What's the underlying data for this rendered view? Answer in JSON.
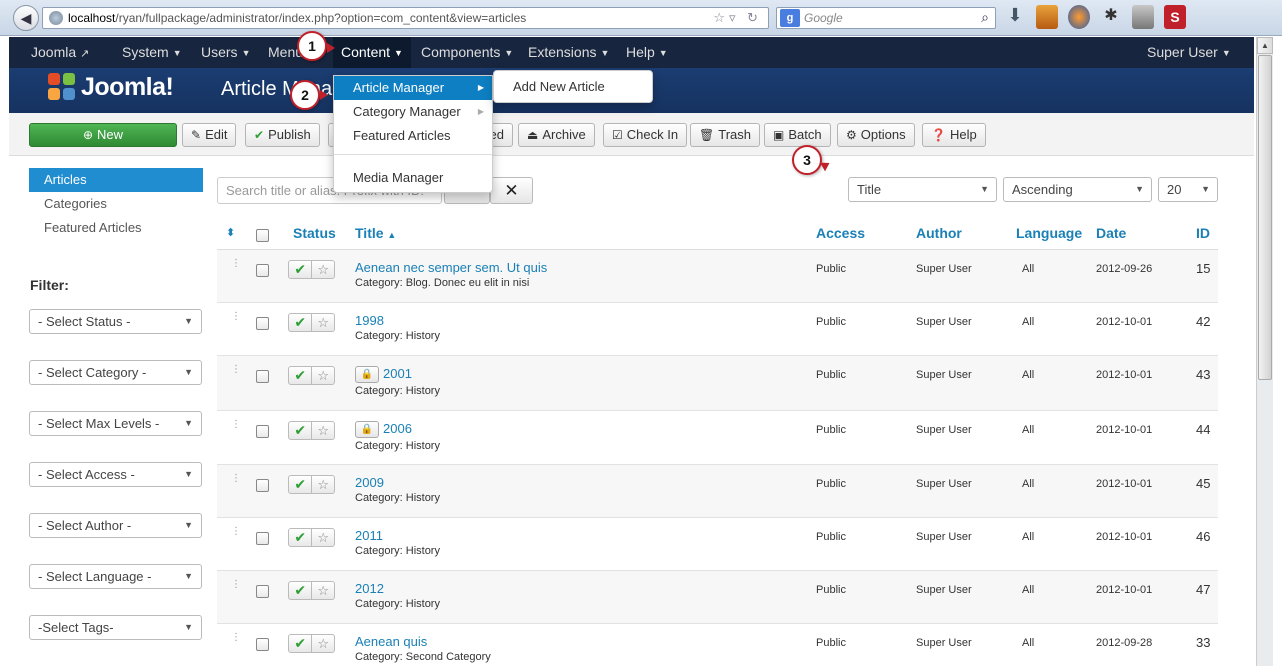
{
  "browser": {
    "url_host": "localhost",
    "url_path": "/ryan/fullpackage/administrator/index.php?option=com_content&view=articles",
    "search_placeholder": "Google",
    "search_engine_letter": "g"
  },
  "navbar": {
    "brand": "Joomla",
    "items": [
      "System",
      "Users",
      "Menus",
      "Content",
      "Components",
      "Extensions",
      "Help"
    ],
    "user": "Super User"
  },
  "header": {
    "logo_text": "Joomla!",
    "title": "Article Manager: Articles"
  },
  "toolbar": {
    "new": "New",
    "edit": "Edit",
    "publish": "Publish",
    "unpublish_fragment": "ed",
    "archive": "Archive",
    "checkin": "Check In",
    "trash": "Trash",
    "batch": "Batch",
    "options": "Options",
    "help": "Help"
  },
  "content_menu": {
    "items": [
      "Article Manager",
      "Category Manager",
      "Featured Articles",
      "Media Manager"
    ],
    "submenu_item": "Add New Article"
  },
  "sidebar": {
    "items": [
      "Articles",
      "Categories",
      "Featured Articles"
    ],
    "filter_title": "Filter:",
    "filters": [
      "- Select Status -",
      "- Select Category -",
      "- Select Max Levels -",
      "- Select Access -",
      "- Select Author -",
      "- Select Language -",
      "-Select Tags-"
    ]
  },
  "list_controls": {
    "search_placeholder": "Search title or alias. Prefix with ID:",
    "sort_field": "Title",
    "sort_direction": "Ascending",
    "limit": "20"
  },
  "table": {
    "columns": [
      "Status",
      "Title",
      "Access",
      "Author",
      "Language",
      "Date",
      "ID"
    ],
    "rows": [
      {
        "title": "Aenean nec semper sem. Ut quis",
        "category": "Category: Blog. Donec eu elit in nisi",
        "access": "Public",
        "author": "Super User",
        "language": "All",
        "date": "2012-09-26",
        "id": "15",
        "locked": false
      },
      {
        "title": "1998",
        "category": "Category: History",
        "access": "Public",
        "author": "Super User",
        "language": "All",
        "date": "2012-10-01",
        "id": "42",
        "locked": false
      },
      {
        "title": "2001",
        "category": "Category: History",
        "access": "Public",
        "author": "Super User",
        "language": "All",
        "date": "2012-10-01",
        "id": "43",
        "locked": true
      },
      {
        "title": "2006",
        "category": "Category: History",
        "access": "Public",
        "author": "Super User",
        "language": "All",
        "date": "2012-10-01",
        "id": "44",
        "locked": true
      },
      {
        "title": "2009",
        "category": "Category: History",
        "access": "Public",
        "author": "Super User",
        "language": "All",
        "date": "2012-10-01",
        "id": "45",
        "locked": false
      },
      {
        "title": "2011",
        "category": "Category: History",
        "access": "Public",
        "author": "Super User",
        "language": "All",
        "date": "2012-10-01",
        "id": "46",
        "locked": false
      },
      {
        "title": "2012",
        "category": "Category: History",
        "access": "Public",
        "author": "Super User",
        "language": "All",
        "date": "2012-10-01",
        "id": "47",
        "locked": false
      },
      {
        "title": "Aenean quis",
        "category": "Category: Second Category",
        "access": "Public",
        "author": "Super User",
        "language": "All",
        "date": "2012-09-28",
        "id": "33",
        "locked": false
      }
    ]
  },
  "callouts": [
    "1",
    "2",
    "3"
  ],
  "colors": {
    "navbar": "#17253e",
    "header": "#1b3d72",
    "accent": "#1f8dd0",
    "link": "#1a80b6",
    "new_button": "#3a9f3f",
    "callout_border": "#c0202a"
  }
}
